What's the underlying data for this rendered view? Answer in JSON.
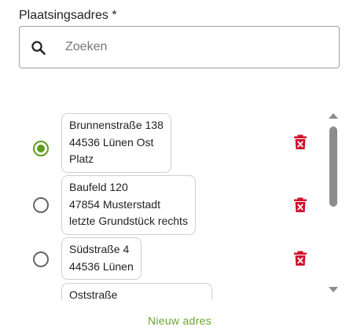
{
  "field": {
    "label": "Plaatsingsadres *",
    "search_placeholder": "Zoeken",
    "search_value": ""
  },
  "addresses": [
    {
      "lines": [
        "Brunnenstraße 138",
        "44536 Lünen Ost",
        "Platz"
      ],
      "selected": true
    },
    {
      "lines": [
        "Baufeld 120",
        "47854 Musterstadt",
        "letzte Grundstück rechts"
      ],
      "selected": false
    },
    {
      "lines": [
        "Südstraße 4",
        "44536 Lünen"
      ],
      "selected": false
    },
    {
      "lines": [
        "Oststraße"
      ],
      "selected": false
    }
  ],
  "icons": {
    "search": "search-icon",
    "delete": "delete-icon",
    "radio_selected": "radio-checked",
    "radio_unselected": "radio-unchecked"
  },
  "actions": {
    "new_address_label": "Nieuw adres"
  },
  "colors": {
    "accent_green": "#5e9c1f",
    "new_address_green": "#6aa532",
    "delete_red": "#d0112b",
    "scrollbar": "#8c8c8c",
    "border": "#9e9e9e"
  }
}
